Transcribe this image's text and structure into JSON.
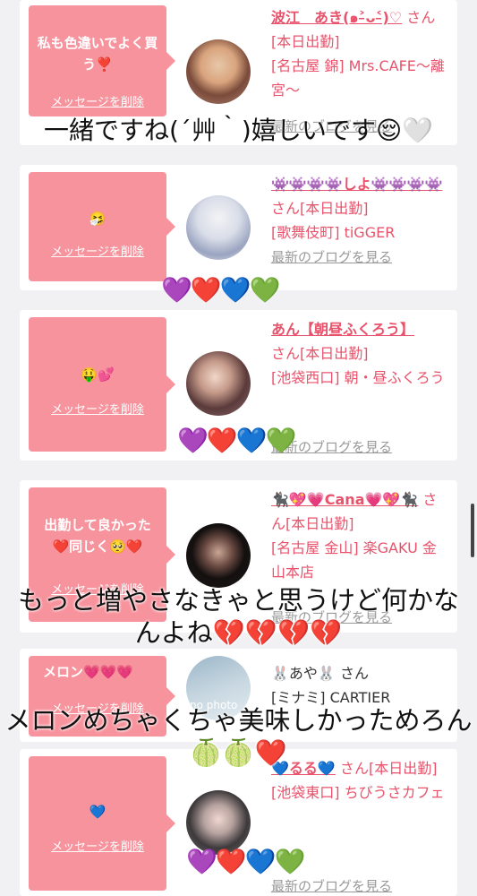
{
  "cards": [
    {
      "message": "私も色違いでよく買う❣️",
      "delete_label": "メッセージを削除",
      "name": "波江　あき(๑˃̵ᴗ˂̵)♡",
      "san": "さん[本日出勤]",
      "shop": "[名古屋 錦] Mrs.CAFE〜離宮〜",
      "blog": "最新のブログを見る"
    },
    {
      "message": "🤧",
      "delete_label": "メッセージを削除",
      "name": "👾👾👾👾しよ👾👾👾👾",
      "san": "さん[本日出勤]",
      "shop": "[歌舞伎町] tiGGER",
      "blog": "最新のブログを見る"
    },
    {
      "message": "🤑💕",
      "delete_label": "メッセージを削除",
      "name": "あん【朝昼ふくろう】",
      "san": "さん[本日出勤]",
      "shop": "[池袋西口] 朝・昼ふくろう",
      "blog": "最新のブログを見る"
    },
    {
      "message": "出勤して良かった❤️同じく🥺❤️",
      "delete_label": "メッセージを削除",
      "name": "🐈‍⬛💖💗Cana💗💖🐈‍⬛",
      "san": "さん[本日出勤]",
      "shop": "[名古屋 金山] 楽GAKU 金山本店",
      "blog": "最新のブログを見る"
    },
    {
      "message": "メロン💗💗💗",
      "delete_label": "メッセージを削除",
      "name": "🐰あや🐰",
      "san": "さん",
      "shop": "[ミナミ] CARTIER",
      "blog": "",
      "avatar_text": "no photo"
    },
    {
      "message": "💙",
      "delete_label": "メッセージを削除",
      "name": "💙るる💙",
      "san": "さん[本日出勤]",
      "shop": "[池袋東口] ちびうさカフェ",
      "blog": "最新のブログを見る"
    }
  ],
  "overlays": {
    "text1": "一緒ですね(´艸｀)嬉しいです😌🤍",
    "hearts1": "💜❤️💙💚",
    "hearts2": "💜❤️💙💚",
    "text3": "もっと増やさなきゃと思うけど何かなんよね💔💔💔💔",
    "text4": "メロンめちゃくちゃ美味しかっためろん🍈🍈❤️",
    "hearts5": "💜❤️💙💚"
  },
  "colors": {
    "bubble": "#f7939d",
    "accent": "#e8526b",
    "link_gray": "#999999"
  }
}
